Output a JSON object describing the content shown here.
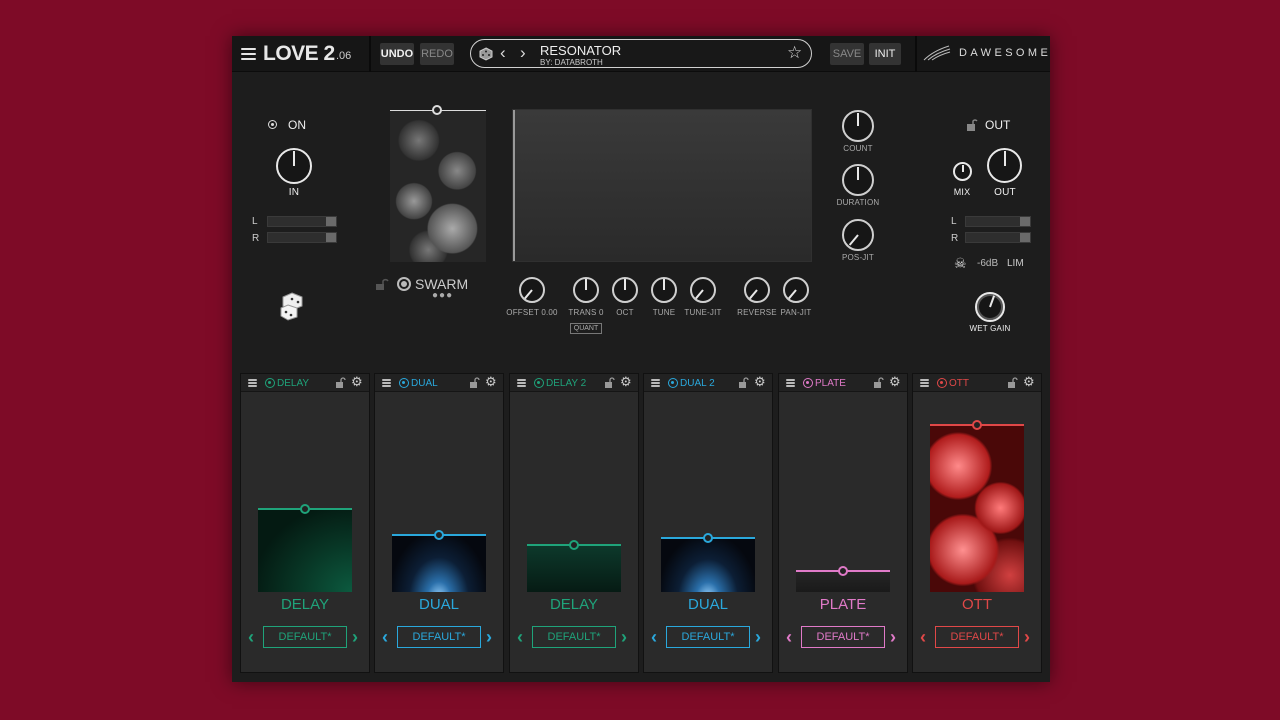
{
  "app": {
    "logo": "LOVE 2",
    "version": ".06",
    "brand": "DAWESOME"
  },
  "toolbar": {
    "undo": "UNDO",
    "redo": "REDO",
    "save": "SAVE",
    "init": "INIT"
  },
  "preset": {
    "name": "RESONATOR",
    "author": "BY: DATABROTH"
  },
  "input": {
    "on_label": "ON",
    "knob_label": "IN",
    "meter_l": "L",
    "meter_r": "R"
  },
  "engine": {
    "name": "SWARM",
    "knobs": {
      "count": "COUNT",
      "duration": "DURATION",
      "pos_jit": "POS-JIT",
      "offset": "OFFSET 0.00",
      "trans": "TRANS 0",
      "oct": "OCT",
      "tune": "TUNE",
      "tune_jit": "TUNE-JIT",
      "reverse": "REVERSE",
      "pan_jit": "PAN-JIT"
    },
    "quant": "QUANT"
  },
  "output": {
    "out_label": "OUT",
    "mix": "MIX",
    "out_knob": "OUT",
    "meter_l": "L",
    "meter_r": "R",
    "gain_db": "-6dB",
    "lim": "LIM",
    "wet_gain": "WET GAIN"
  },
  "colors": {
    "background": "#7e0b27",
    "green": "#1fa37a",
    "blue": "#2aa8dc",
    "pink": "#e07ac8",
    "red": "#e04848"
  },
  "slots": [
    {
      "header": "DELAY",
      "title": "DELAY",
      "preset": "DEFAULT*",
      "color": "#1fa37a"
    },
    {
      "header": "DUAL",
      "title": "DUAL",
      "preset": "DEFAULT*",
      "color": "#2aa8dc"
    },
    {
      "header": "DELAY 2",
      "title": "DELAY",
      "preset": "DEFAULT*",
      "color": "#1fa37a"
    },
    {
      "header": "DUAL 2",
      "title": "DUAL",
      "preset": "DEFAULT*",
      "color": "#2aa8dc"
    },
    {
      "header": "PLATE",
      "title": "PLATE",
      "preset": "DEFAULT*",
      "color": "#e07ac8"
    },
    {
      "header": "OTT",
      "title": "OTT",
      "preset": "DEFAULT*",
      "color": "#e04848"
    }
  ]
}
